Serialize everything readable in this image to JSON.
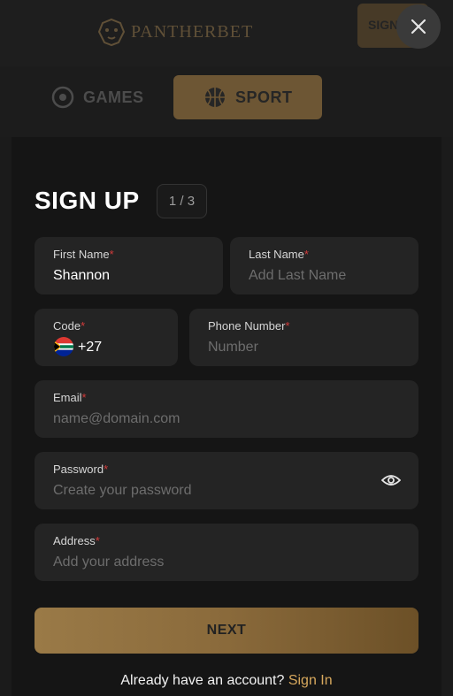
{
  "header": {
    "logo_text": "PANTHERBET",
    "partial_button_label": "SIGN"
  },
  "nav": {
    "tabs": [
      {
        "label": "GAMES",
        "icon": "dice-icon",
        "active": false
      },
      {
        "label": "SPORT",
        "icon": "basketball-icon",
        "active": true
      }
    ]
  },
  "modal": {
    "title": "SIGN UP",
    "step": "1 / 3",
    "fields": {
      "first_name": {
        "label": "First Name",
        "value": "Shannon",
        "placeholder": ""
      },
      "last_name": {
        "label": "Last Name",
        "value": "",
        "placeholder": "Add Last Name"
      },
      "code": {
        "label": "Code",
        "value": "+27",
        "flag": "south-africa-flag-icon"
      },
      "phone": {
        "label": "Phone Number",
        "value": "",
        "placeholder": "Number"
      },
      "email": {
        "label": "Email",
        "value": "",
        "placeholder": "name@domain.com"
      },
      "password": {
        "label": "Password",
        "value": "",
        "placeholder": "Create your password"
      },
      "address": {
        "label": "Address",
        "value": "",
        "placeholder": "Add your address"
      }
    },
    "required_marker": "*",
    "next_label": "NEXT",
    "footer_text": "Already have an account?",
    "signin_label": "Sign In"
  },
  "colors": {
    "accent": "#9a7a47",
    "link": "#d7a85d",
    "required": "#d23b3b",
    "field_bg": "#242424",
    "modal_bg": "#151515"
  }
}
